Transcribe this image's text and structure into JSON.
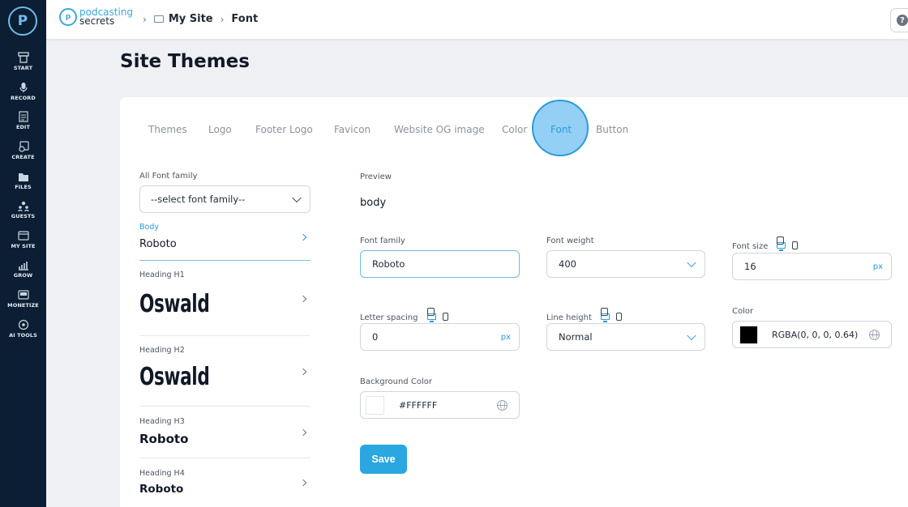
{
  "sidebar": {
    "brand": "P",
    "items": [
      {
        "label": "START",
        "icon": "start-icon"
      },
      {
        "label": "RECORD",
        "icon": "microphone-icon"
      },
      {
        "label": "EDIT",
        "icon": "edit-icon"
      },
      {
        "label": "CREATE",
        "icon": "create-icon"
      },
      {
        "label": "FILES",
        "icon": "files-icon"
      },
      {
        "label": "GUESTS",
        "icon": "guests-icon"
      },
      {
        "label": "MY SITE",
        "icon": "my-site-icon"
      },
      {
        "label": "GROW",
        "icon": "grow-icon"
      },
      {
        "label": "MONETIZE",
        "icon": "monetize-icon"
      },
      {
        "label": "AI TOOLS",
        "icon": "ai-tools-icon"
      }
    ]
  },
  "topbar": {
    "logo_line1": "podcasting",
    "logo_line2": "secrets",
    "breadcrumb": [
      "My Site",
      "Font"
    ],
    "help": "?"
  },
  "page_title": "Site Themes",
  "tabs": [
    "Themes",
    "Logo",
    "Footer Logo",
    "Favicon",
    "Website OG image",
    "Color",
    "Font",
    "Button"
  ],
  "active_tab": "Font",
  "font_list": {
    "label": "All Font family",
    "select_value": "--select font family--",
    "items": [
      {
        "label": "Body",
        "font": "Roboto"
      },
      {
        "label": "Heading H1",
        "font": "Oswald"
      },
      {
        "label": "Heading H2",
        "font": "Oswald"
      },
      {
        "label": "Heading H3",
        "font": "Roboto"
      },
      {
        "label": "Heading H4",
        "font": "Roboto"
      }
    ]
  },
  "preview": {
    "label": "Preview",
    "text": "body"
  },
  "form": {
    "font_family_label": "Font family",
    "font_family_value": "Roboto",
    "font_weight_label": "Font weight",
    "font_weight_value": "400",
    "font_size_label": "Font size",
    "font_size_value": "16",
    "font_size_unit": "px",
    "letter_spacing_label": "Letter spacing",
    "letter_spacing_value": "0",
    "letter_spacing_unit": "px",
    "line_height_label": "Line height",
    "line_height_value": "Normal",
    "color_label": "Color",
    "color_value": "RGBA(0, 0, 0, 0.64)",
    "color_swatch": "#000000",
    "bg_color_label": "Background Color",
    "bg_color_value": "#FFFFFF",
    "bg_swatch": "#ffffff",
    "save_label": "Save"
  },
  "colors": {
    "accent": "#2aa6e0",
    "sidebar_bg": "#0b1e33"
  }
}
